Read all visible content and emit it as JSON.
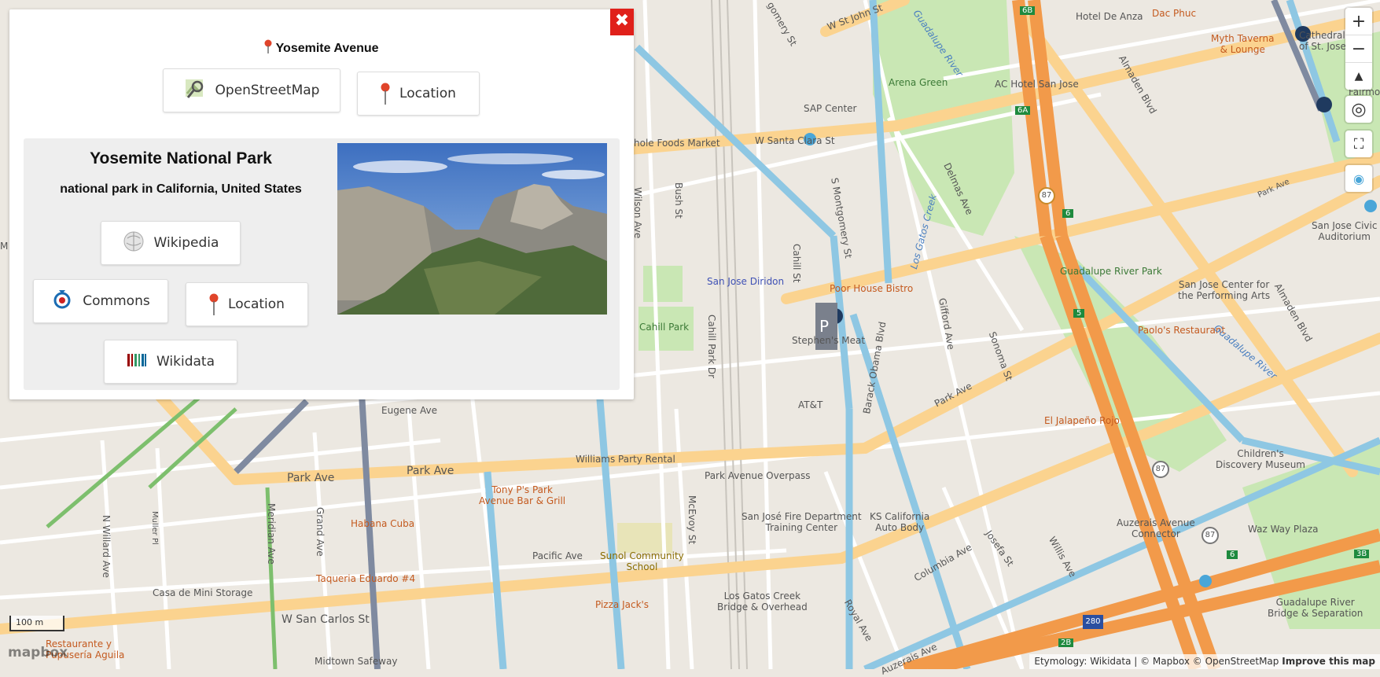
{
  "popup": {
    "title": "Yosemite Avenue",
    "osm_label": "OpenStreetMap",
    "location_label": "Location",
    "close_symbol": "✖",
    "card": {
      "title": "Yosemite National Park",
      "subtitle": "national park in California, United States",
      "wikipedia_label": "Wikipedia",
      "commons_label": "Commons",
      "location_label": "Location",
      "wikidata_label": "Wikidata"
    }
  },
  "controls": {
    "zoom_in": "+",
    "zoom_out": "−",
    "compass": "▲",
    "geolocate": "◎",
    "fullscreen": "⛶",
    "layers": "◉"
  },
  "scale_label": "100 m",
  "logo": "mapbox",
  "attribution": {
    "text": "Etymology: Wikidata | © Mapbox © OpenStreetMap",
    "improve": "Improve this map"
  },
  "map_labels": {
    "w_st_john": "W St John St",
    "gomery": "gomery St",
    "guadalupe_river_1": "Guadalupe River",
    "guadalupe_river_2": "Guadalupe River",
    "arena_green": "Arena Green",
    "ac_hotel": "AC Hotel San Jose",
    "sap": "SAP Center",
    "hotel_de_anza": "Hotel De Anza",
    "dac_phuc": "Dac Phuc",
    "myth_taverna": "Myth Taverna\n& Lounge",
    "cathedral": "Cathedral Basil\nof St. Joseph",
    "fairmont": "Fairmo",
    "almaden_1": "Almaden Blvd",
    "almaden_2": "Almaden Blvd",
    "w_santa_clara": "W Santa Clara St",
    "whole_foods": "hole Foods Market",
    "wilson": "Wilson Ave",
    "bush": "Bush St",
    "s_montgomery": "S Montgomery St",
    "delmas": "Delmas Ave",
    "los_gatos_creek": "Los Gatos Creek",
    "cahill_st": "Cahill St",
    "sj_diridon": "San Jose Diridon",
    "poor_house": "Poor House Bistro",
    "stephens_meat": "Stephen's Meat",
    "cahill_park": "Cahill Park",
    "cahill_park_dr": "Cahill Park Dr",
    "barack_obama": "Barack Obama Blvd",
    "gifford": "Gifford Ave",
    "sonoma": "Sonoma St",
    "guadalupe_river_park": "Guadalupe River Park",
    "sj_center_arts": "San Jose Center for\nthe Performing Arts",
    "sj_civic": "San Jose Civic\nAuditorium",
    "park_ave_e": "Park Ave",
    "paolos": "Paolo's Restaurant",
    "att": "AT&T",
    "el_jalapeno": "El Jalapeño Rojo",
    "eugene": "Eugene Ave",
    "williams_party": "Williams Party Rental",
    "park_avenue_overpass": "Park Avenue Overpass",
    "park_ave_w1": "Park Ave",
    "park_ave_w2": "Park Ave",
    "tony_ps": "Tony P's Park\nAvenue Bar & Grill",
    "habana_cuba": "Habana Cuba",
    "sj_fire": "San José Fire Department\nTraining Center",
    "ks_california": "KS California\nAuto Body",
    "childrens": "Children's\nDiscovery Museum",
    "auzerais_conn": "Auzerais Avenue\nConnector",
    "waz_way": "Waz Way Plaza",
    "n_willard": "N Willard Ave",
    "muller": "Muller Pl",
    "grand": "Grand Ave",
    "meridian": "Meridian Ave",
    "pacific": "Pacific Ave",
    "sunol": "Sunol Community\nSchool",
    "mcevoy": "McEvoy St",
    "columbia": "Columbia Ave",
    "josefa": "Josefa St",
    "willis": "Willis Ave",
    "casa_mini": "Casa de Mini Storage",
    "taqueria": "Taqueria Eduardo #4",
    "pizza_jacks": "Pizza Jack's",
    "los_gatos_bridge": "Los Gatos Creek\nBridge & Overhead",
    "royal": "Royal Ave",
    "w_san_carlos": "W San Carlos St",
    "restaurante": "Restaurante y\nPupusería Aguila",
    "midtown": "Midtown Safeway",
    "guad_bridge": "Guadalupe River\nBridge & Separation",
    "auzerais_ave": "Auzerais Ave",
    "hwy_87a": "87",
    "hwy_87b": "87",
    "hwy_87c": "87",
    "hwy_280": "280",
    "exit_6b": "6B",
    "exit_6a": "6A",
    "exit_6": "6",
    "exit_5": "5",
    "exit_6c": "6",
    "exit_3b": "3B",
    "exit_2b": "2B",
    "park_ave_ne": "Park Ave",
    "m_edge": "M"
  },
  "colors": {
    "close": "#e0201a",
    "freeway": "#f29a4a",
    "primary_road": "#fbd38f",
    "transit": "#8ec7e3",
    "park": "#c9e7b4"
  }
}
